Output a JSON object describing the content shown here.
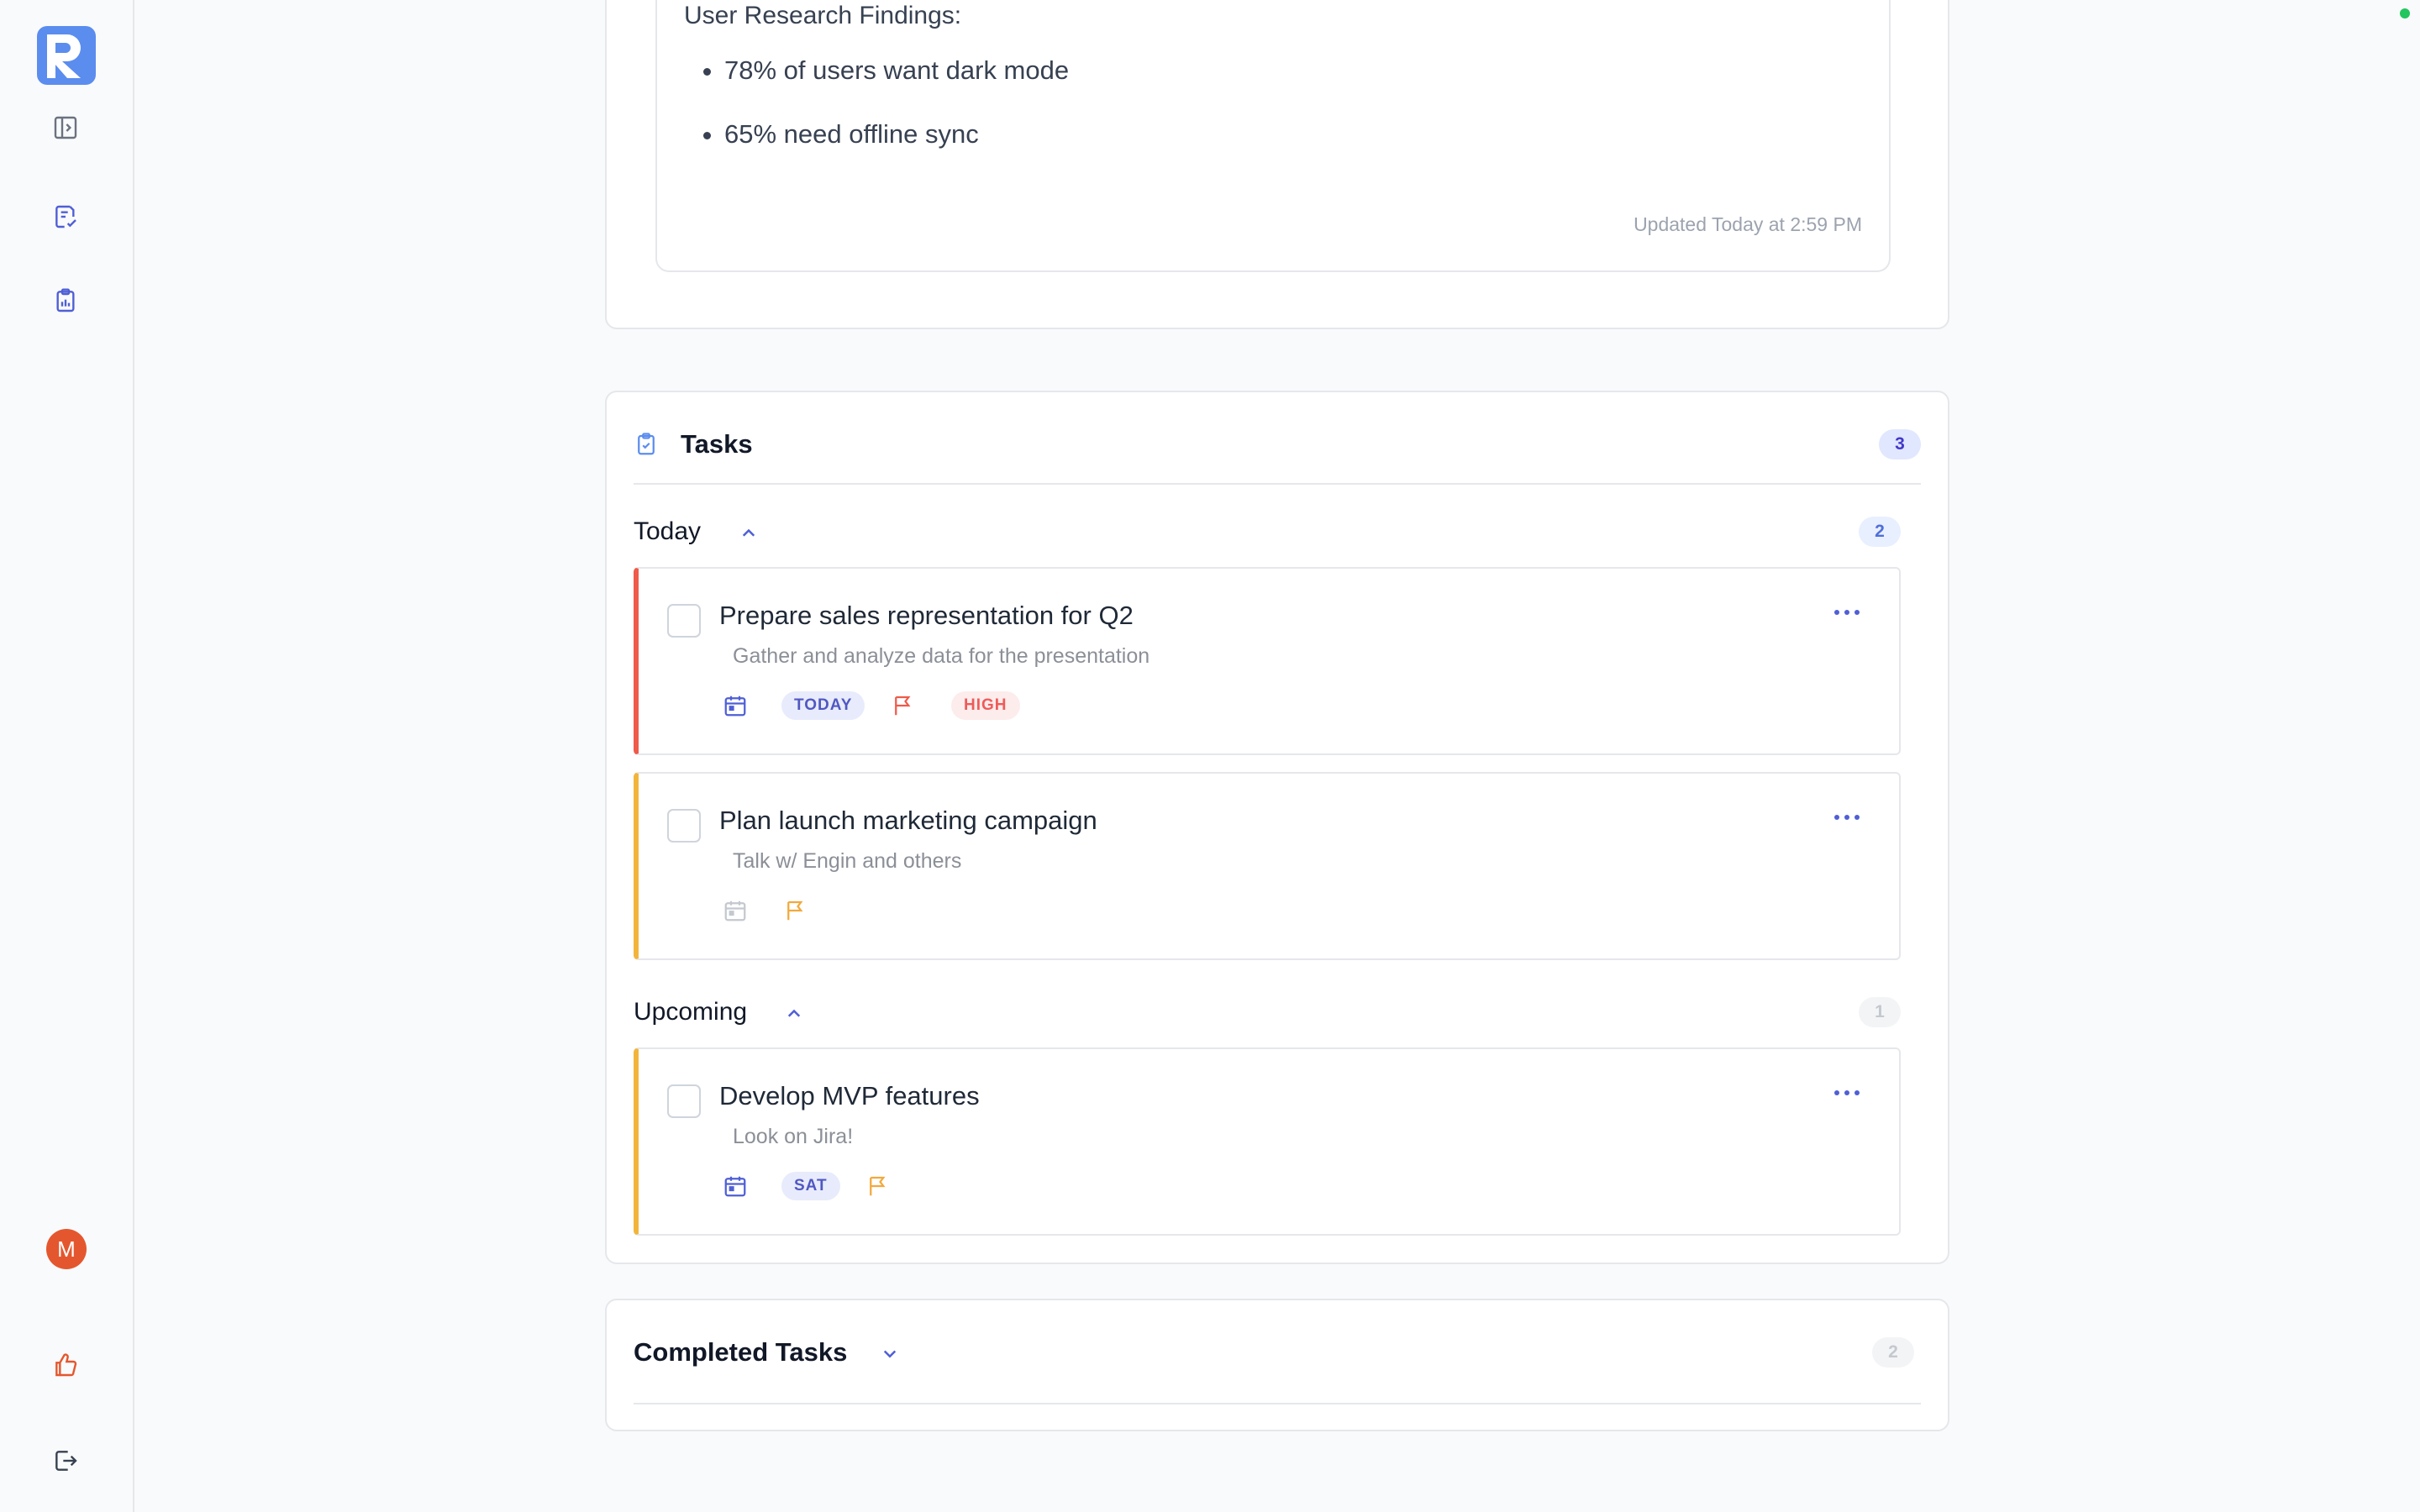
{
  "note": {
    "heading": "User Research Findings:",
    "bullets": [
      "78% of users want dark mode",
      "65% need offline sync"
    ],
    "updated": "Updated Today at 2:59 PM"
  },
  "user": {
    "initial": "M"
  },
  "tasks": {
    "title": "Tasks",
    "count": "3",
    "today": {
      "label": "Today",
      "count": "2",
      "items": [
        {
          "title": "Prepare sales representation for Q2",
          "description": "Gather and analyze data for the presentation",
          "date_tag": "TODAY",
          "priority_tag": "HIGH"
        },
        {
          "title": "Plan launch marketing campaign",
          "description": "Talk w/ Engin and others"
        }
      ]
    },
    "upcoming": {
      "label": "Upcoming",
      "count": "1",
      "items": [
        {
          "title": "Develop MVP features",
          "description": "Look on Jira!",
          "date_tag": "SAT"
        }
      ]
    }
  },
  "completed": {
    "title": "Completed Tasks",
    "count": "2"
  },
  "colors": {
    "accent": "#5b8def",
    "indigo": "#4f46e5",
    "high_priority": "#ef5a4a",
    "medium_priority": "#f2b53c",
    "avatar": "#e4572e",
    "online": "#22c55e"
  },
  "icons": {
    "sidebar": [
      "panel-toggle-icon",
      "notes-check-icon",
      "clipboard-chart-icon",
      "thumbs-up-icon",
      "logout-icon"
    ],
    "task_meta": [
      "calendar-icon",
      "flag-icon",
      "more-horizontal-icon"
    ]
  }
}
